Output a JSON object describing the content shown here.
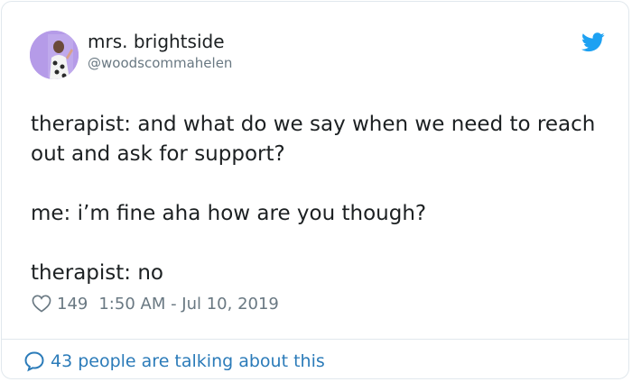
{
  "user": {
    "display_name": "mrs. brightside",
    "handle": "@woodscommahelen",
    "avatar_bg": "#b59be8"
  },
  "tweet": {
    "lines": [
      "therapist: and what do we say when we need to reach out and ask for support?",
      "me: i’m fine aha how are you though?",
      "therapist: no"
    ]
  },
  "meta": {
    "like_count": "149",
    "timestamp": "1:50 AM - Jul 10, 2019"
  },
  "footer": {
    "talking_text": "43 people are talking about this"
  },
  "colors": {
    "twitter_blue": "#1da1f2",
    "link_blue": "#2b7bb9",
    "muted_gray": "#697882",
    "border": "#e1e8ed"
  },
  "icons": {
    "brand": "twitter-bird-icon",
    "like": "heart-icon",
    "reply": "speech-bubble-icon"
  }
}
